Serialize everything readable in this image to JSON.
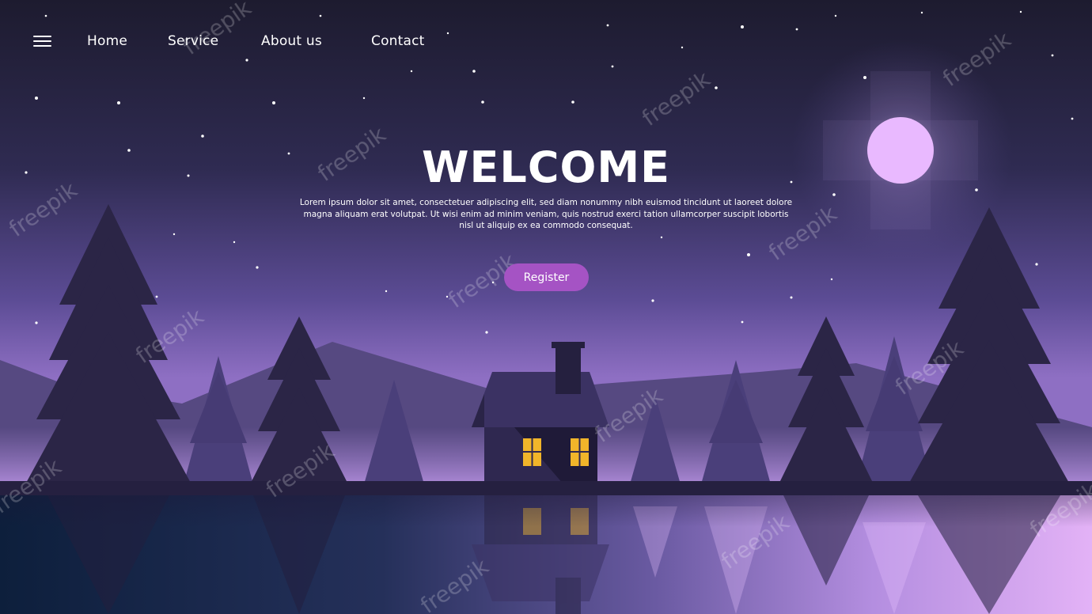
{
  "nav": {
    "menu_icon": "hamburger-menu-icon",
    "links": [
      {
        "label": "Home"
      },
      {
        "label": "Service"
      },
      {
        "label": "About us"
      },
      {
        "label": "Contact"
      }
    ]
  },
  "hero": {
    "title": "WELCOME",
    "body": "Lorem ipsum dolor sit amet, consectetuer adipiscing elit, sed diam nonummy nibh euismod tincidunt ut laoreet dolore magna aliquam erat volutpat. Ut wisi enim ad minim veniam, quis nostrud exerci tation ullamcorper suscipit lobortis nisl ut aliquip ex ea commodo consequat.",
    "cta_label": "Register"
  },
  "watermark": "freepik",
  "colors": {
    "sky_top": "#1d1b2f",
    "sky_bottom": "#8e6fc3",
    "moon": "#e9b9ff",
    "trees_back": "#4a3f7a",
    "trees_front": "#2a2545",
    "window_light": "#f1b52a",
    "button": "#a553c4",
    "water_left": "#0e2240",
    "water_right": "#d7a6f0"
  }
}
